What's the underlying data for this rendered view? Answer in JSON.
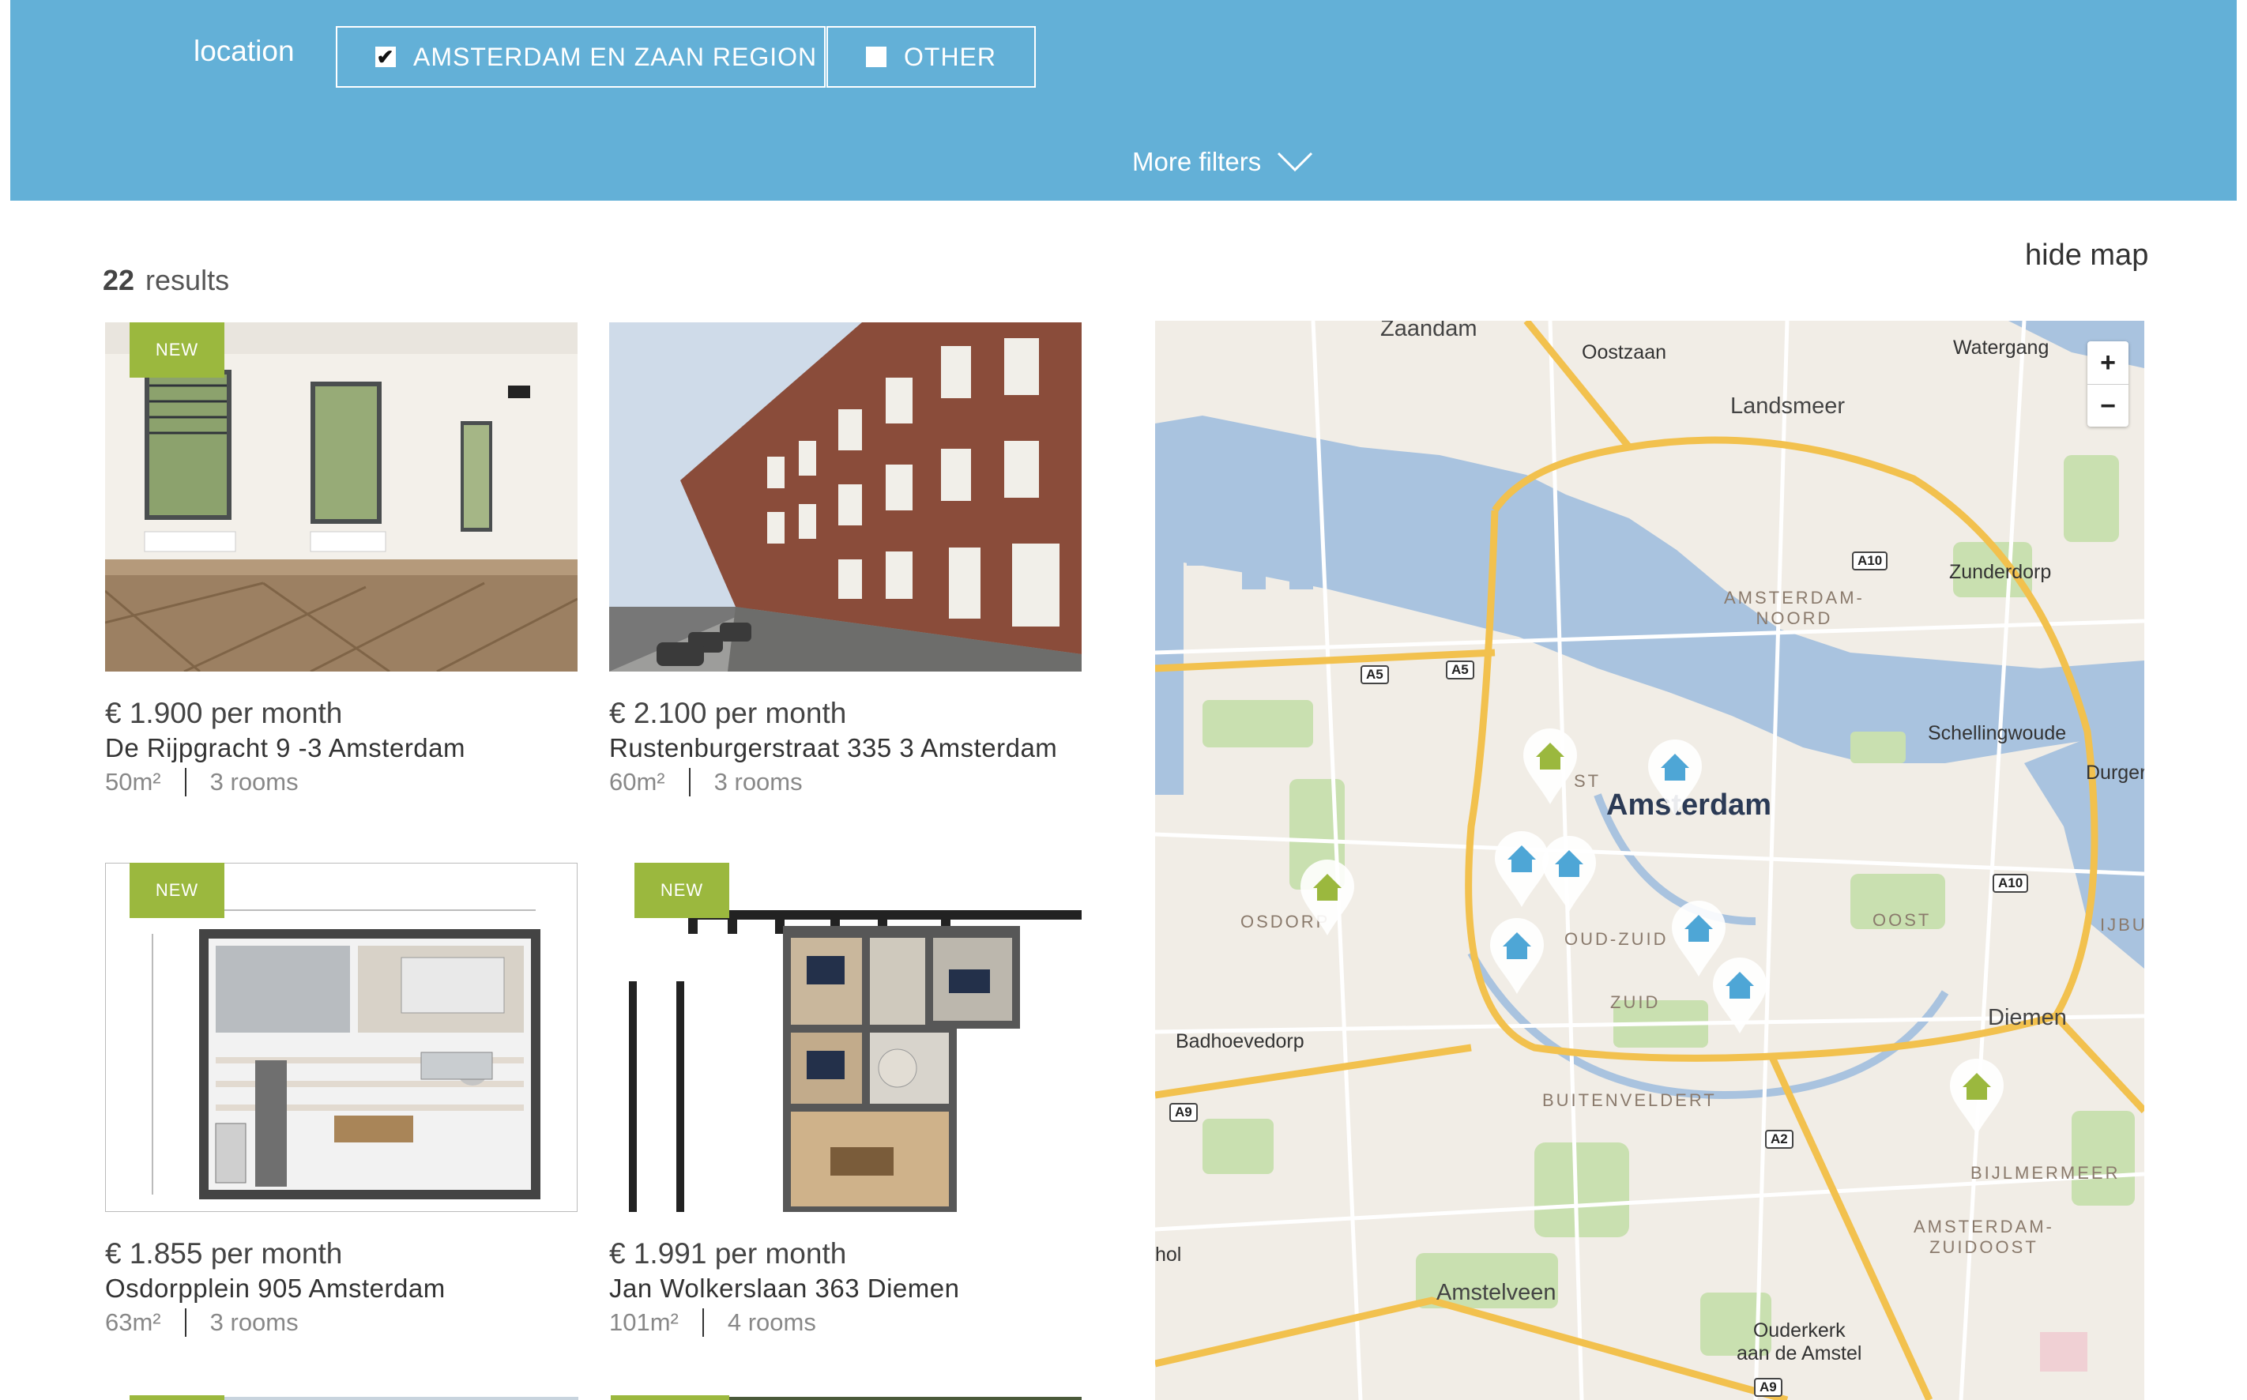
{
  "filters": {
    "location_label": "location",
    "options": [
      {
        "label": "AMSTERDAM EN ZAAN REGION",
        "checked": true
      },
      {
        "label": "OTHER",
        "checked": false
      }
    ],
    "more_filters": "More filters"
  },
  "results": {
    "count": "22",
    "label": "results"
  },
  "hide_map": "hide map",
  "listings": [
    {
      "badge": "NEW",
      "price": "€ 1.900 per month",
      "address": "De Rijpgracht 9 -3 Amsterdam",
      "area": "50m²",
      "rooms": "3 rooms"
    },
    {
      "badge": "",
      "price": "€ 2.100 per month",
      "address": "Rustenburgerstraat 335 3 Amsterdam",
      "area": "60m²",
      "rooms": "3 rooms"
    },
    {
      "badge": "NEW",
      "price": "€ 1.855 per month",
      "address": "Osdorpplein 905 Amsterdam",
      "area": "63m²",
      "rooms": "3 rooms"
    },
    {
      "badge": "NEW",
      "price": "€ 1.991 per month",
      "address": "Jan Wolkerslaan 363 Diemen",
      "area": "101m²",
      "rooms": "4 rooms"
    }
  ],
  "map": {
    "zoom_in": "+",
    "zoom_out": "−",
    "places": {
      "zaandam": "Zaandam",
      "oostzaan": "Oostzaan",
      "watergang": "Watergang",
      "landsmeer": "Landsmeer",
      "zunderdorp": "Zunderdorp",
      "amsterdam_noord": "AMSTERDAM-\nNOORD",
      "schellingwoude": "Schellingwoude",
      "durgerdam": "Durgerdam",
      "amsterdam": "Amsterdam",
      "osdorp": "OSDORP",
      "oud_zuid": "OUD-ZUID",
      "oost": "OOST",
      "zuid": "ZUID",
      "diemen": "Diemen",
      "badhoevedorp": "Badhoevedorp",
      "buitenveldert": "BUITENVELDERT",
      "bijlmermeer": "BIJLMERMEER",
      "amsterdam_zuidoost": "AMSTERDAM-\nZUIDOOST",
      "amstelveen": "Amstelveen",
      "ouderkerk": "Ouderkerk\naan de Amstel",
      "schiphol": "hol",
      "ijburg": "IJBU",
      "west": "ST"
    },
    "roads": {
      "a10_n": "A10",
      "a5_a": "A5",
      "a5_b": "A5",
      "a10_e": "A10",
      "a9_w": "A9",
      "a2": "A2",
      "a9_s": "A9"
    },
    "pin_colors": {
      "new": "#9bb83e",
      "regular": "#4ea6d6"
    }
  }
}
